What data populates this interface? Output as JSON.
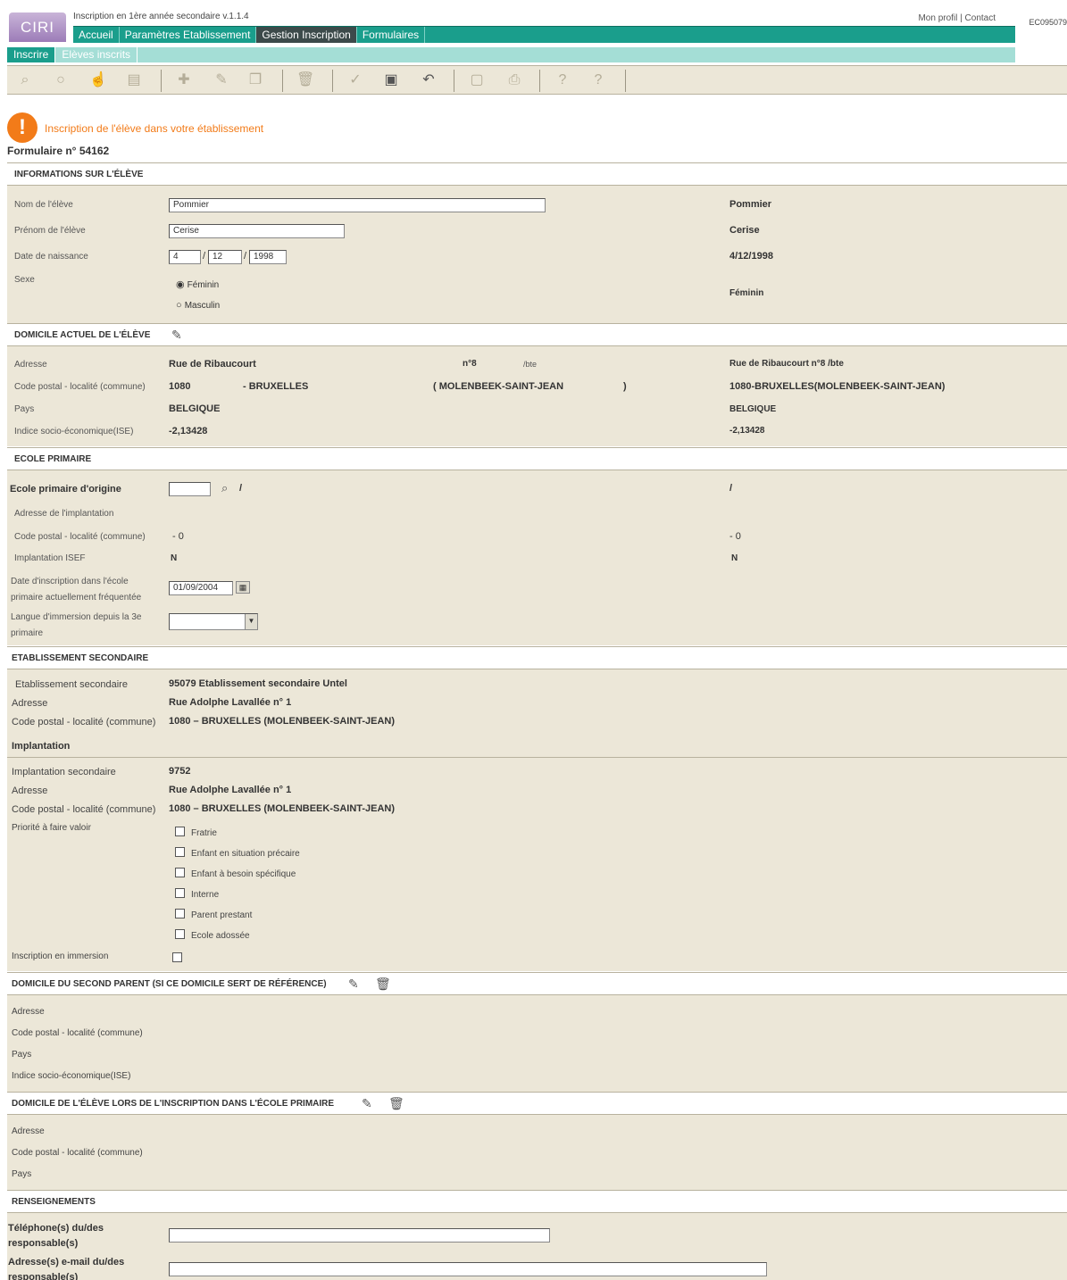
{
  "app": {
    "logo": "CIRI",
    "title": "Inscription en 1ère année secondaire v.1.1.4",
    "top_links": "Mon profil | Contact",
    "user_code": "EC095079"
  },
  "main_nav": [
    "Accueil",
    "Paramètres Etablissement",
    "Gestion Inscription",
    "Formulaires"
  ],
  "sub_nav": [
    "Inscrire",
    "Elèves inscrits"
  ],
  "page": {
    "warning": "Inscription de l'élève dans votre établissement",
    "form_number": "Formulaire n° 54162"
  },
  "eleve": {
    "header": "INFORMATIONS SUR L'ÉLÈVE",
    "nom_label": "Nom de l'élève",
    "nom_value": "Pommier",
    "prenom_label": "Prénom de l'élève",
    "prenom_value": "Cerise",
    "dob_label": "Date de naissance",
    "dob_day": "4",
    "dob_month": "12",
    "dob_year": "1998",
    "dob_sep": "/",
    "dob_display": "4/12/1998",
    "sexe_label": "Sexe",
    "sexe_f": "Féminin",
    "sexe_m": "Masculin",
    "sexe_display": "Féminin"
  },
  "domicile": {
    "header": "DOMICILE ACTUEL DE L'ÉLÈVE",
    "adresse_label": "Adresse",
    "rue": "Rue de Ribaucourt",
    "num": "n°8",
    "bte": "/bte",
    "adresse_display": "Rue de Ribaucourt  n°8  /bte",
    "cp_label": "Code postal - localité (commune)",
    "cp": "1080",
    "localite": "- BRUXELLES",
    "commune": "( MOLENBEEK-SAINT-JEAN",
    "commune_close": ")",
    "cp_display": "1080-BRUXELLES(MOLENBEEK-SAINT-JEAN)",
    "pays_label": "Pays",
    "pays": "BELGIQUE",
    "ise_label": "Indice socio-économique(ISE)",
    "ise": "-2,13428"
  },
  "primaire": {
    "header": "ECOLE PRIMAIRE",
    "origine_label": "Ecole primaire d'origine",
    "origine_sep": "/",
    "adresse_label": "Adresse de l'implantation",
    "cp_label": "Code postal - localité (commune)",
    "cp_value": "- 0",
    "isef_label": "Implantation ISEF",
    "isef_value": "N",
    "date_label": "Date d'inscription dans l'école primaire actuellement fréquentée",
    "date_value": "01/09/2004",
    "langue_label": "Langue d'immersion depuis la 3e primaire"
  },
  "secondaire": {
    "header": "ETABLISSEMENT SECONDAIRE",
    "etab_label": "Etablissement secondaire",
    "etab_value": "95079 Etablissement secondaire Untel",
    "adresse_label": "Adresse",
    "adresse_value": "Rue Adolphe Lavallée n° 1",
    "cp_label": "Code postal - localité (commune)",
    "cp_value": "1080 – BRUXELLES (MOLENBEEK-SAINT-JEAN)",
    "implantation_title": "Implantation",
    "impl_label": "Implantation secondaire",
    "impl_value": "9752",
    "priorite_label": "Priorité à faire valoir",
    "priorites": [
      "Fratrie",
      "Enfant en situation précaire",
      "Enfant à besoin spécifique",
      "Interne",
      "Parent prestant",
      "Ecole adossée"
    ],
    "immersion_label": "Inscription en immersion"
  },
  "second_parent": {
    "header": "DOMICILE DU SECOND PARENT (SI CE DOMICILE SERT DE RÉFÉRENCE)",
    "labels": [
      "Adresse",
      "Code postal - localité (commune)",
      "Pays",
      "Indice socio-économique(ISE)"
    ]
  },
  "domicile_primaire": {
    "header": "DOMICILE DE L'ÉLÈVE LORS DE L'INSCRIPTION DANS L'ÉCOLE PRIMAIRE",
    "labels": [
      "Adresse",
      "Code postal - localité (commune)",
      "Pays"
    ]
  },
  "renseignements": {
    "header": "RENSEIGNEMENTS",
    "tel_label": "Téléphone(s) du/des responsable(s)",
    "email_label": "Adresse(s) e-mail du/des responsable(s)"
  }
}
